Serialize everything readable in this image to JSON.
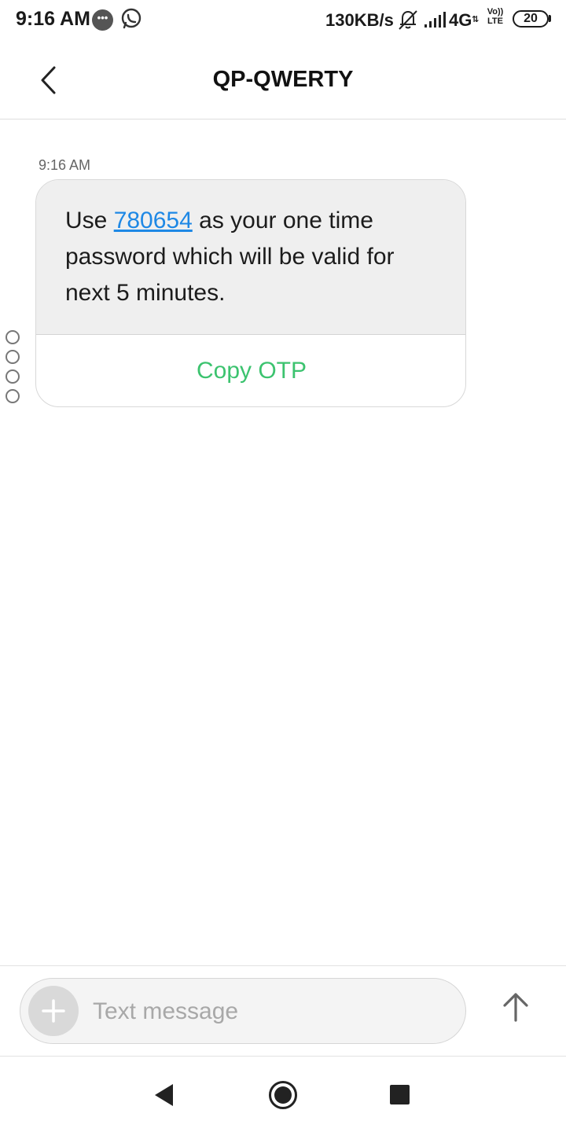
{
  "status_bar": {
    "time": "9:16 AM",
    "message_icon": "chat-bubble-dots-icon",
    "whatsapp_icon": "whatsapp-icon",
    "net_speed": "130KB/s",
    "mute_icon": "bell-off-icon",
    "signal_icon": "signal-bars-icon",
    "network": "4G",
    "volte_top": "Vo))",
    "volte_bottom": "LTE",
    "battery": "20"
  },
  "header": {
    "title": "QP-QWERTY",
    "back_icon": "chevron-left-icon"
  },
  "conversation": {
    "messages": [
      {
        "time": "9:16 AM",
        "text_before": "Use ",
        "otp": "780654",
        "text_after": " as your one time password which will be valid for next 5 minutes.",
        "action_label": "Copy OTP"
      }
    ]
  },
  "composer": {
    "placeholder": "Text message",
    "value": "",
    "add_icon": "plus-icon",
    "send_icon": "arrow-up-icon"
  },
  "nav_bar": {
    "back_icon": "triangle-back-icon",
    "home_icon": "circle-home-icon",
    "recents_icon": "square-recents-icon"
  },
  "colors": {
    "accent_link": "#1e88e5",
    "action_green": "#3cc36f",
    "bubble_bg": "#efefef"
  }
}
